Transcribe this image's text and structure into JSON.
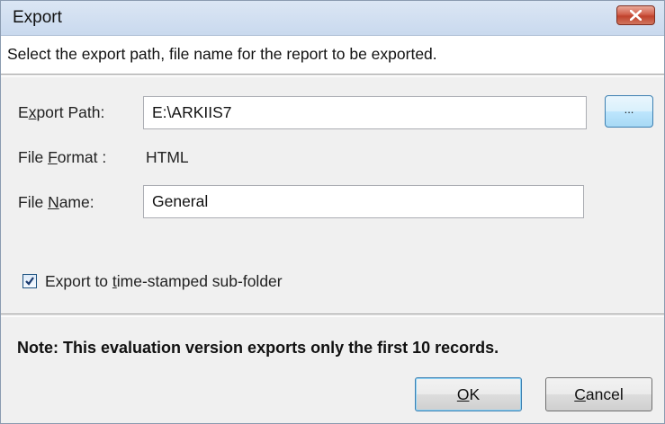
{
  "window": {
    "title": "Export",
    "close_icon": "close-icon"
  },
  "header": {
    "instruction": "Select the export path, file name for the report to be exported."
  },
  "form": {
    "export_path": {
      "label_pre": "E",
      "label_accel": "x",
      "label_post": "port Path:",
      "value": "E:\\ARKIIS7"
    },
    "browse_label": "...",
    "file_format": {
      "label_pre": "File ",
      "label_accel": "F",
      "label_post": "ormat :",
      "value": "HTML"
    },
    "file_name": {
      "label_pre": "File ",
      "label_accel": "N",
      "label_post": "ame:",
      "value": "General"
    },
    "timestamp_checkbox": {
      "checked": true,
      "label_pre": "Export to ",
      "label_accel": "t",
      "label_post": "ime-stamped sub-folder"
    }
  },
  "note": "Note:  This evaluation version exports only the first  10 records.",
  "buttons": {
    "ok_accel": "O",
    "ok_post": "K",
    "cancel_accel": "C",
    "cancel_post": "ancel"
  },
  "colors": {
    "close_button": "#c0412c",
    "title_bar": "#c9d9ee",
    "dialog_bg": "#f0f0f0",
    "focus_border": "#3c7fb1"
  }
}
